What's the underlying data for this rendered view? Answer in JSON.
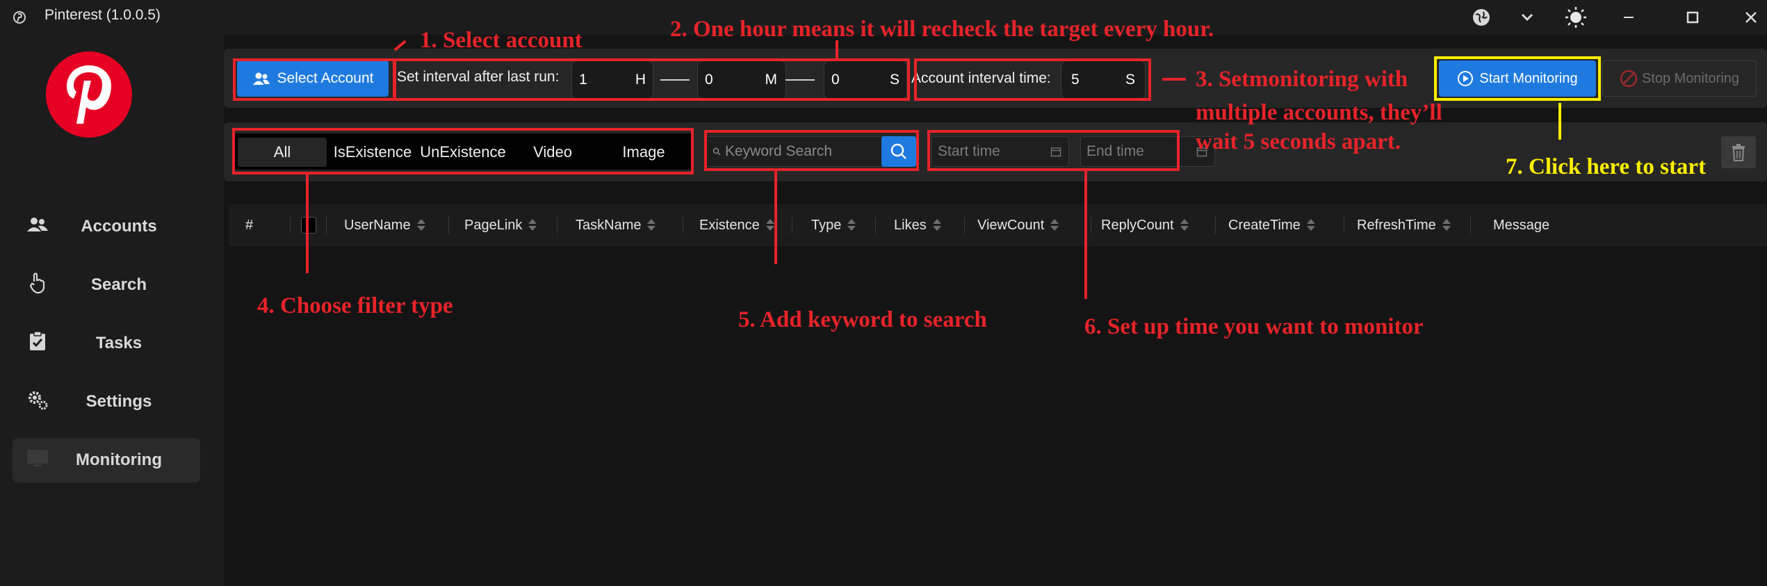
{
  "window": {
    "title": "Pinterest (1.0.0.5)",
    "controls": [
      "globe-icon",
      "chevron-down-icon",
      "sun-icon",
      "minimize-icon",
      "maximize-icon",
      "close-icon"
    ]
  },
  "sidebar": {
    "logo": "P",
    "items": [
      {
        "label": "Accounts",
        "icon": "users-icon",
        "active": false
      },
      {
        "label": "Search",
        "icon": "hand-pointer-icon",
        "active": false
      },
      {
        "label": "Tasks",
        "icon": "clipboard-check-icon",
        "active": false
      },
      {
        "label": "Settings",
        "icon": "gears-icon",
        "active": false
      },
      {
        "label": "Monitoring",
        "icon": "monitor-icon",
        "active": true
      }
    ]
  },
  "toolbar": {
    "select_account_label": "Select Account",
    "interval_label": "Set interval after last run:",
    "hours_value": "1",
    "hours_unit": "H",
    "minutes_value": "0",
    "minutes_unit": "M",
    "seconds_value": "0",
    "seconds_unit": "S",
    "account_interval_label": "Account interval time:",
    "account_interval_value": "5",
    "account_interval_unit": "S",
    "start_label": "Start Monitoring",
    "stop_label": "Stop Monitoring"
  },
  "filters": {
    "tabs": [
      "All",
      "IsExistence",
      "UnExistence",
      "Video",
      "Image"
    ],
    "selected": "All",
    "search_placeholder": "Keyword Search",
    "start_time_placeholder": "Start time",
    "end_time_placeholder": "End time"
  },
  "table": {
    "columns": [
      "#",
      "UserName",
      "PageLink",
      "TaskName",
      "Existence",
      "Type",
      "Likes",
      "ViewCount",
      "ReplyCount",
      "CreateTime",
      "RefreshTime",
      "Message"
    ],
    "rows": []
  },
  "annotations": {
    "a1": "1. Select account",
    "a2": "2. One hour means it will recheck the target every hour.",
    "a3_line1": "3. Setmonitoring with",
    "a3_line2": "multiple accounts, they’ll",
    "a3_line3": "wait 5 seconds apart.",
    "a4": "4. Choose  filter type",
    "a5": "5. Add keyword to search",
    "a6": "6. Set up time you want to monitor",
    "a7": "7. Click here to start",
    "red": "#e8232a",
    "yellow": "#ffee00"
  },
  "colors": {
    "accent": "#1f7ae0",
    "brand": "#e60023"
  }
}
